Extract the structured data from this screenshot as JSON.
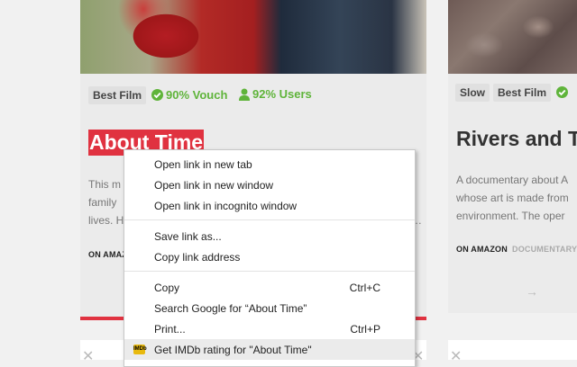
{
  "card1": {
    "tags": [
      "Best Film"
    ],
    "vouch": "90% Vouch",
    "users": "92% Users",
    "title": "About Time",
    "desc_lines": [
      "This m",
      "family",
      "lives. H"
    ],
    "desc_right": "…",
    "source": "ON AMAZ"
  },
  "card2": {
    "tags": [
      "Slow",
      "Best Film"
    ],
    "title": "Rivers and T",
    "desc_lines": [
      "A documentary about A",
      "whose art is made from",
      "environment. The oper"
    ],
    "source": "ON AMAZON",
    "genre": "DOCUMENTARY",
    "arrow": "→"
  },
  "lower": {
    "close_symbol": "✕"
  },
  "context_menu": {
    "items": [
      {
        "label": "Open link in new tab",
        "shortcut": ""
      },
      {
        "label": "Open link in new window",
        "shortcut": ""
      },
      {
        "label": "Open link in incognito window",
        "shortcut": ""
      },
      {
        "label": "Save link as...",
        "shortcut": ""
      },
      {
        "label": "Copy link address",
        "shortcut": ""
      },
      {
        "label": "Copy",
        "shortcut": "Ctrl+C"
      },
      {
        "label": "Search Google for “About Time”",
        "shortcut": ""
      },
      {
        "label": "Print...",
        "shortcut": "Ctrl+P"
      },
      {
        "label": "Get IMDb rating for \"About Time\"",
        "shortcut": "",
        "icon": "imdb-icon",
        "icon_text": "IMDb"
      }
    ]
  },
  "colors": {
    "accent": "#e03240",
    "green": "#5fb43a",
    "imdb": "#e8b90e"
  }
}
